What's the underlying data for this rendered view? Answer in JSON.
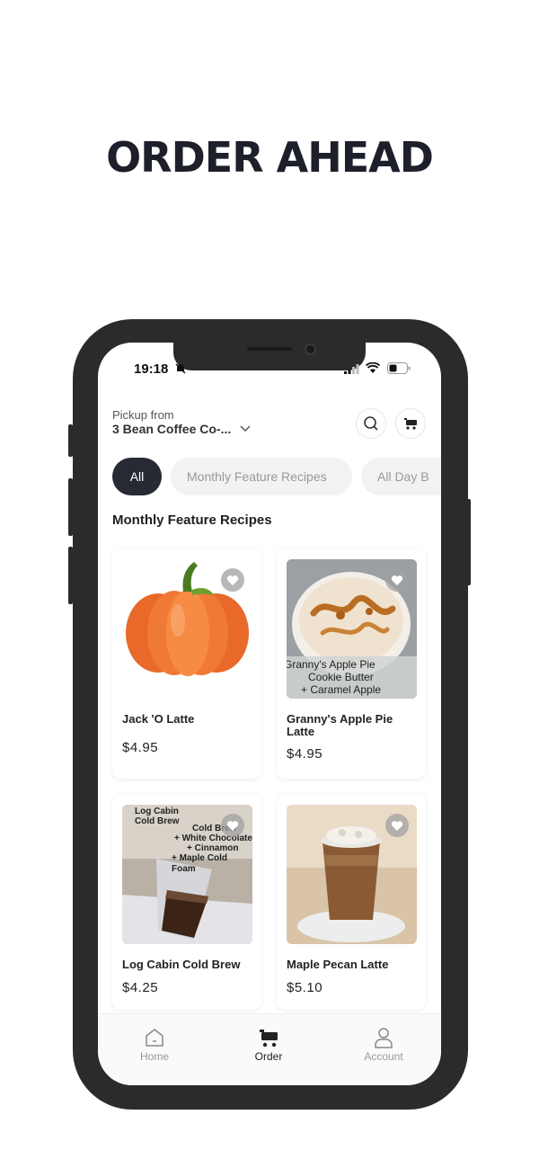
{
  "headline": "ORDER AHEAD",
  "status_bar": {
    "time": "19:18"
  },
  "header": {
    "pickup_label": "Pickup from",
    "store_name": "3 Bean Coffee Co-..."
  },
  "chips": [
    {
      "label": "All",
      "selected": true
    },
    {
      "label": "Monthly Feature Recipes",
      "selected": false
    },
    {
      "label": "All Day B",
      "selected": false
    }
  ],
  "section_title": "Monthly Feature Recipes",
  "products": [
    {
      "name": "Jack 'O Latte",
      "price": "$4.95",
      "image_icon": "pumpkin"
    },
    {
      "name": "Granny's Apple Pie Latte",
      "price": "$4.95",
      "image_icon": "whipped-latte",
      "image_text": [
        "Granny's Apple Pie",
        "Cookie Butter",
        "+ Caramel Apple"
      ]
    },
    {
      "name": "Log Cabin Cold Brew",
      "price": "$4.25",
      "image_icon": "cold-brew-glass",
      "image_text": [
        "Log Cabin",
        "Cold Brew",
        "Cold Brew",
        "+ White Chocolate",
        "+ Cinnamon",
        "+ Maple Cold Foam"
      ]
    },
    {
      "name": "Maple Pecan Latte",
      "price": "$5.10",
      "image_icon": "iced-latte-cup"
    }
  ],
  "tabs": [
    {
      "label": "Home",
      "icon": "home-icon",
      "active": false
    },
    {
      "label": "Order",
      "icon": "cart-icon",
      "active": true
    },
    {
      "label": "Account",
      "icon": "user-icon",
      "active": false
    }
  ],
  "colors": {
    "dark": "#272a33",
    "chip_bg": "#f2f2f2",
    "frame": "#2b2b2d"
  }
}
